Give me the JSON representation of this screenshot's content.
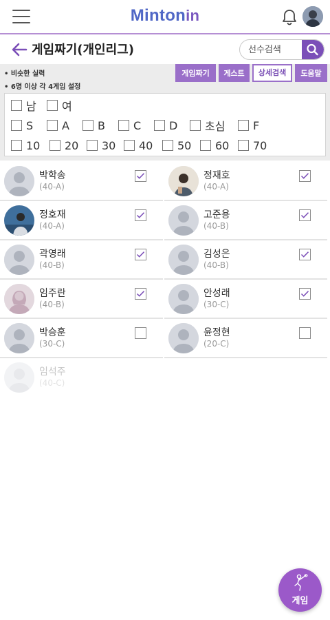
{
  "header": {
    "logo_main": "Minton",
    "logo_sub": "in",
    "menu_icon": "hamburger-menu-icon",
    "bell_icon": "bell-icon"
  },
  "title_bar": {
    "title": "게임짜기(개인리그)",
    "back_icon": "arrow-left-icon",
    "search_placeholder": "선수검색",
    "search_icon": "search-icon"
  },
  "filter": {
    "notes": [
      "• 비슷한 실력",
      "• 6명 이상 각 4게임 설정"
    ],
    "buttons": [
      {
        "label": "게임짜기",
        "style": "filled"
      },
      {
        "label": "게스트",
        "style": "filled"
      },
      {
        "label": "상세검색",
        "style": "outline"
      },
      {
        "label": "도움말",
        "style": "filled"
      }
    ],
    "gender": [
      "남",
      "여"
    ],
    "grade": [
      "S",
      "A",
      "B",
      "C",
      "D",
      "초심",
      "F"
    ],
    "age": [
      "10",
      "20",
      "30",
      "40",
      "50",
      "60",
      "70"
    ]
  },
  "players": [
    {
      "name": "박학송",
      "grade": "(40-A)",
      "checked": true,
      "photo": "placeholder"
    },
    {
      "name": "정재호",
      "grade": "(40-A)",
      "checked": true,
      "photo": "photo"
    },
    {
      "name": "정호재",
      "grade": "(40-A)",
      "checked": true,
      "photo": "photo"
    },
    {
      "name": "고준용",
      "grade": "(40-B)",
      "checked": true,
      "photo": "placeholder"
    },
    {
      "name": "곽영래",
      "grade": "(40-B)",
      "checked": true,
      "photo": "placeholder"
    },
    {
      "name": "김성은",
      "grade": "(40-B)",
      "checked": true,
      "photo": "placeholder"
    },
    {
      "name": "임주란",
      "grade": "(40-B)",
      "checked": true,
      "photo": "placeholder-female"
    },
    {
      "name": "안성래",
      "grade": "(30-C)",
      "checked": true,
      "photo": "placeholder"
    },
    {
      "name": "박승훈",
      "grade": "(30-C)",
      "checked": false,
      "photo": "placeholder"
    },
    {
      "name": "윤정현",
      "grade": "(20-C)",
      "checked": false,
      "photo": "placeholder"
    },
    {
      "name": "임석주",
      "grade": "(40-C)",
      "checked": false,
      "photo": "placeholder",
      "faded": true
    }
  ],
  "fab": {
    "label": "게임",
    "icon": "badminton-player-icon"
  },
  "colors": {
    "accent": "#9a6fc9",
    "brand_blue": "#5067c6",
    "fab": "#9b59c9",
    "check": "#7b4fb8"
  }
}
